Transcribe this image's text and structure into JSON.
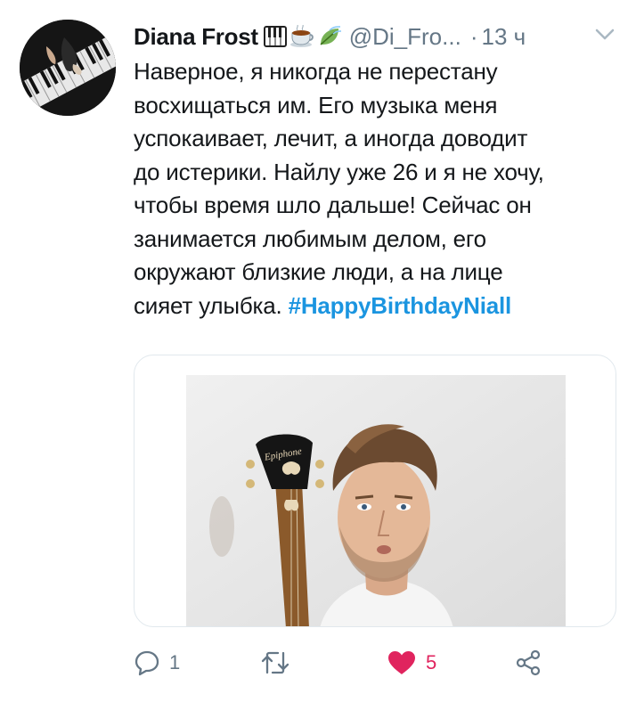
{
  "tweet": {
    "author_name": "Diana Frost",
    "emojis": [
      "piano-keys-emoji",
      "teacup-emoji",
      "leaf-wind-emoji"
    ],
    "handle": "@Di_Fro...",
    "separator": "·",
    "time": "13 ч",
    "text_lines": [
      "Наверное, я никогда не перестану",
      "восхищаться им. Его музыка меня",
      "успокаивает, лечит, а иногда доводит",
      "до истерики. Найлу уже 26 и я не хочу,",
      "чтобы время шло дальше! Сейчас он",
      "занимается любимым делом, его",
      "окружают близкие люди, а на лице"
    ],
    "last_line_text": "сияет улыбка. ",
    "hashtag": "#HappyBirthdayNiall",
    "guitar_brand": "Epiphone"
  },
  "actions": {
    "reply_count": "1",
    "retweet_count": "",
    "like_count": "5"
  },
  "colors": {
    "link": "#1b95e0",
    "secondary": "#657786",
    "like": "#e0245e",
    "border": "#e1e8ed"
  }
}
